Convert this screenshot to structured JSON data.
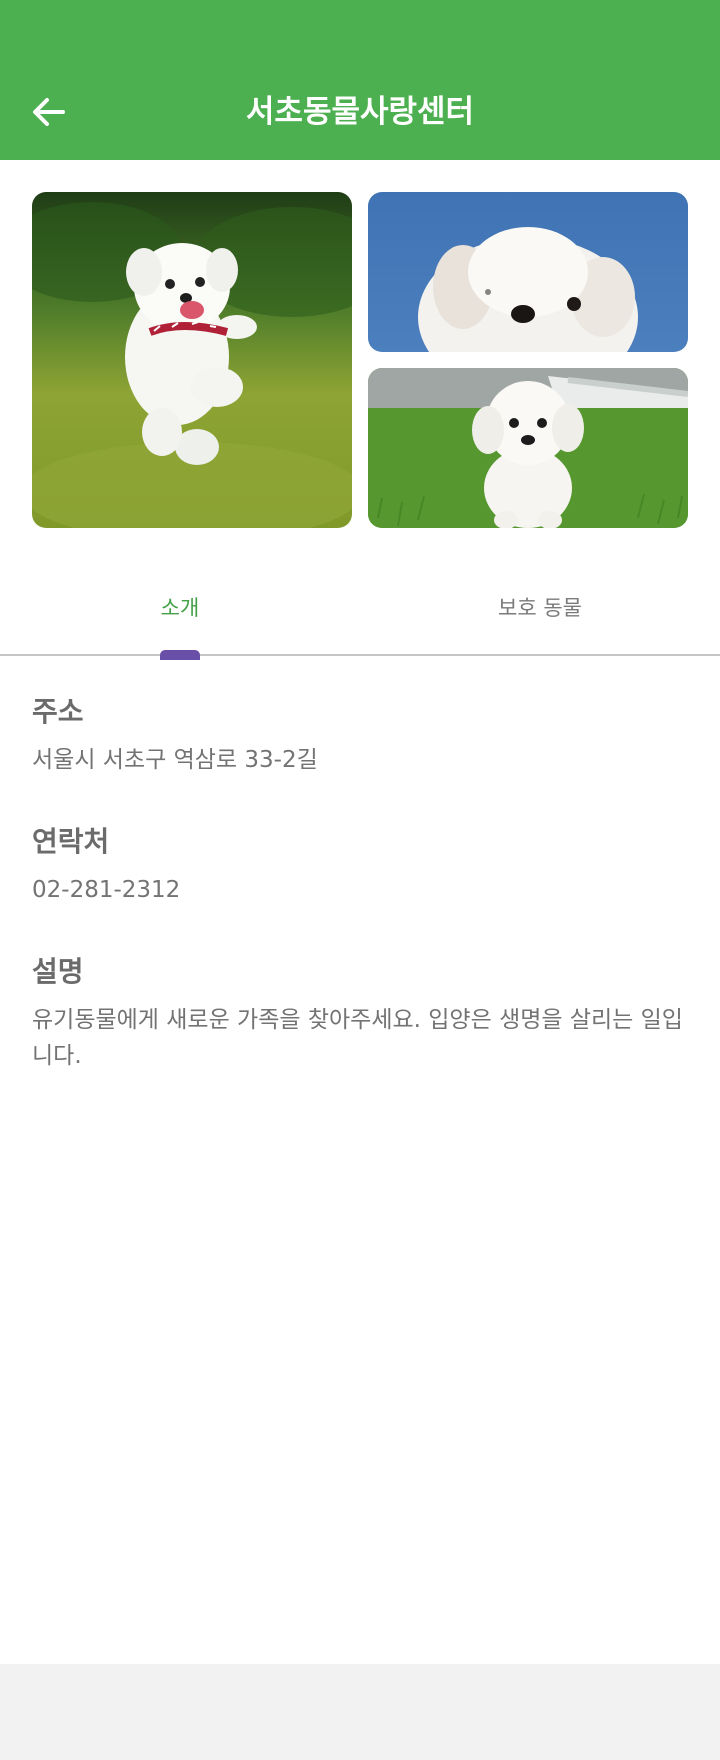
{
  "appbar": {
    "title": "서초동물사랑센터",
    "back_icon": "arrow-left-icon",
    "color": "#4caf50"
  },
  "photos": [
    {
      "subject": "white puppy running on grass"
    },
    {
      "subject": "white puppy face against blue sky"
    },
    {
      "subject": "white poodle puppy on artificial turf"
    }
  ],
  "tabs": [
    {
      "label": "소개",
      "selected": true
    },
    {
      "label": "보호 동물",
      "selected": false
    }
  ],
  "details": {
    "address_title": "주소",
    "address_value": "서울시 서초구 역삼로 33-2길",
    "contact_title": "연락처",
    "contact_value": "02-281-2312",
    "description_title": "설명",
    "description_value": "유기동물에게 새로운 가족을 찾아주세요. 입양은 생명을 살리는 일입니다."
  },
  "colors": {
    "accent": "#4caf50",
    "selected_tab_text": "#43a047",
    "indicator": "#6a4fa8"
  }
}
